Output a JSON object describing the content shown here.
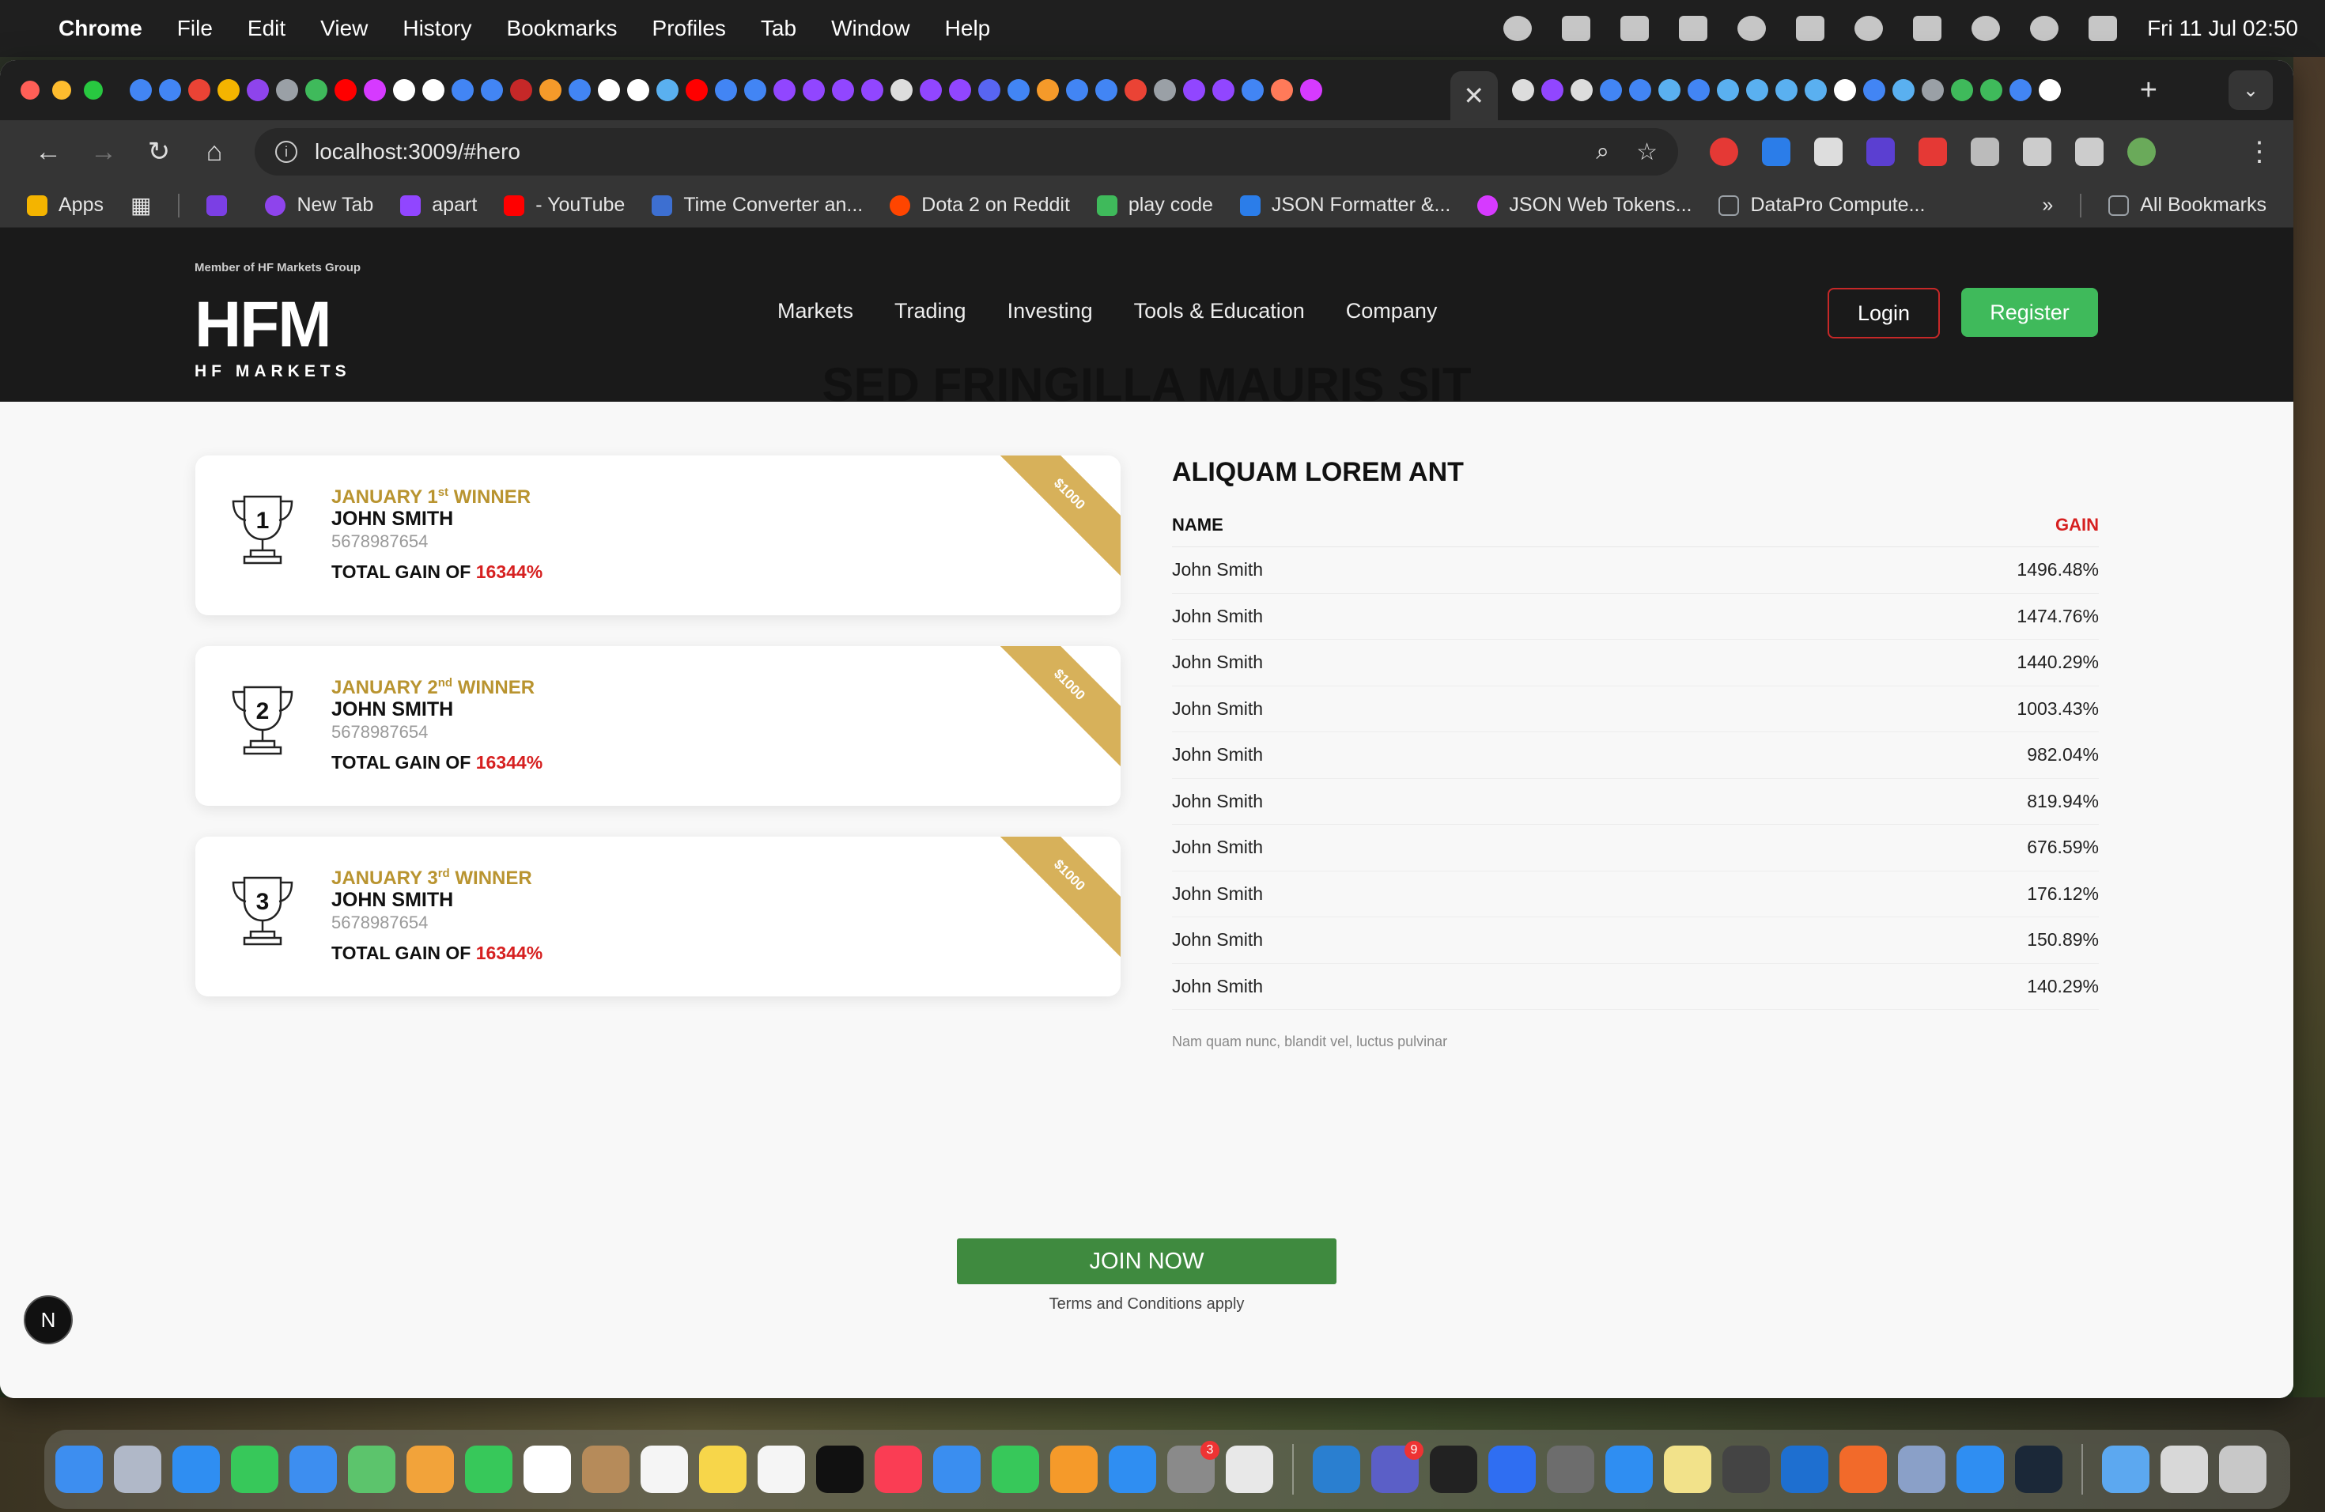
{
  "menubar": {
    "app_name": "Chrome",
    "items": [
      "File",
      "Edit",
      "View",
      "History",
      "Bookmarks",
      "Profiles",
      "Tab",
      "Window",
      "Help"
    ],
    "clock": "Fri 11 Jul  02:50"
  },
  "browser": {
    "url": "localhost:3009/#hero",
    "active_tab_close": "✕",
    "new_tab": "+",
    "bookmarks": [
      {
        "label": "Apps",
        "color": "#f4b400"
      },
      {
        "label": "New Tab",
        "color": "#8e44ec"
      },
      {
        "label": "apart",
        "color": "#9146ff"
      },
      {
        "label": "- YouTube",
        "color": "#ff0000"
      },
      {
        "label": "Time Converter an...",
        "color": "#3d6fd1"
      },
      {
        "label": "Dota 2 on Reddit",
        "color": "#ff4500"
      },
      {
        "label": "play code",
        "color": "#3fba5b"
      },
      {
        "label": "JSON Formatter &...",
        "color": "#2b7de9"
      },
      {
        "label": "JSON Web Tokens...",
        "color": "#d63aff"
      },
      {
        "label": "DataPro Compute...",
        "color": "#9aa0a6"
      }
    ],
    "bookmarks_overflow": "»",
    "all_bookmarks": "All Bookmarks"
  },
  "site": {
    "member_text": "Member of HF Markets Group",
    "logo_main": "HFM",
    "logo_sub": "HF MARKETS",
    "nav": [
      "Markets",
      "Trading",
      "Investing",
      "Tools & Education",
      "Company"
    ],
    "login": "Login",
    "register": "Register"
  },
  "section": {
    "title": "SED FRINGILLA MAURIS SIT",
    "winners": [
      {
        "rank": "1",
        "month": "JANUARY 1",
        "suffix": "st",
        "label": "WINNER",
        "name": "JOHN SMITH",
        "account": "5678987654",
        "total_prefix": "TOTAL GAIN OF",
        "total_value": "16344%",
        "prize": "$1000"
      },
      {
        "rank": "2",
        "month": "JANUARY 2",
        "suffix": "nd",
        "label": "WINNER",
        "name": "JOHN SMITH",
        "account": "5678987654",
        "total_prefix": "TOTAL GAIN OF",
        "total_value": "16344%",
        "prize": "$1000"
      },
      {
        "rank": "3",
        "month": "JANUARY 3",
        "suffix": "rd",
        "label": "WINNER",
        "name": "JOHN SMITH",
        "account": "5678987654",
        "total_prefix": "TOTAL GAIN OF",
        "total_value": "16344%",
        "prize": "$1000"
      }
    ],
    "leaderboard": {
      "title": "ALIQUAM LOREM ANT",
      "col_name": "NAME",
      "col_gain": "GAIN",
      "rows": [
        {
          "name": "John Smith",
          "gain": "1496.48%"
        },
        {
          "name": "John Smith",
          "gain": "1474.76%"
        },
        {
          "name": "John Smith",
          "gain": "1440.29%"
        },
        {
          "name": "John Smith",
          "gain": "1003.43%"
        },
        {
          "name": "John Smith",
          "gain": "982.04%"
        },
        {
          "name": "John Smith",
          "gain": "819.94%"
        },
        {
          "name": "John Smith",
          "gain": "676.59%"
        },
        {
          "name": "John Smith",
          "gain": "176.12%"
        },
        {
          "name": "John Smith",
          "gain": "150.89%"
        },
        {
          "name": "John Smith",
          "gain": "140.29%"
        }
      ],
      "note": "Nam quam nunc, blandit vel, luctus pulvinar"
    },
    "join": "JOIN NOW",
    "terms": "Terms and Conditions apply"
  },
  "next_badge": "N",
  "dock": {
    "apps": [
      {
        "name": "finder",
        "color": "#3d8ef0"
      },
      {
        "name": "launchpad",
        "color": "#b0b8c8"
      },
      {
        "name": "safari",
        "color": "#2f8ef2"
      },
      {
        "name": "messages",
        "color": "#37c85a"
      },
      {
        "name": "mail",
        "color": "#3d8ef0"
      },
      {
        "name": "maps",
        "color": "#5cc46c"
      },
      {
        "name": "photos",
        "color": "#f2a33a"
      },
      {
        "name": "facetime",
        "color": "#37c85a"
      },
      {
        "name": "calendar",
        "color": "#ffffff"
      },
      {
        "name": "contacts",
        "color": "#b68b5a"
      },
      {
        "name": "reminders",
        "color": "#f5f5f5"
      },
      {
        "name": "notes",
        "color": "#f7d64a"
      },
      {
        "name": "freeform",
        "color": "#f5f5f5"
      },
      {
        "name": "tv",
        "color": "#111111"
      },
      {
        "name": "music",
        "color": "#fa3d54"
      },
      {
        "name": "keynote",
        "color": "#3a8ef0"
      },
      {
        "name": "numbers",
        "color": "#37c85a"
      },
      {
        "name": "pages",
        "color": "#f59a2a"
      },
      {
        "name": "app-store",
        "color": "#2f8ef2"
      },
      {
        "name": "system-settings",
        "color": "#8a8a8a"
      },
      {
        "name": "chrome",
        "color": "#e8e8e8"
      },
      {
        "name": "vscode",
        "color": "#2a7fd0"
      },
      {
        "name": "teams",
        "color": "#5b5fc7"
      },
      {
        "name": "terminal",
        "color": "#222222"
      },
      {
        "name": "tunnel",
        "color": "#2f6ef2"
      },
      {
        "name": "gimp",
        "color": "#6d6d6d"
      },
      {
        "name": "location",
        "color": "#2f8ef2"
      },
      {
        "name": "stickies",
        "color": "#f2e28a"
      },
      {
        "name": "utility",
        "color": "#444444"
      },
      {
        "name": "outlook",
        "color": "#1e6fd0"
      },
      {
        "name": "pencil",
        "color": "#f26a2a"
      },
      {
        "name": "remote",
        "color": "#8aa0c8"
      },
      {
        "name": "windows-app",
        "color": "#2f8ef2"
      },
      {
        "name": "steam",
        "color": "#1b2838"
      },
      {
        "name": "downloads",
        "color": "#5ca8f0"
      },
      {
        "name": "screenshots",
        "color": "#d8d8d8"
      },
      {
        "name": "trash",
        "color": "#c8c8c8"
      }
    ],
    "badges": {
      "system-settings": "3",
      "teams": "9"
    }
  }
}
